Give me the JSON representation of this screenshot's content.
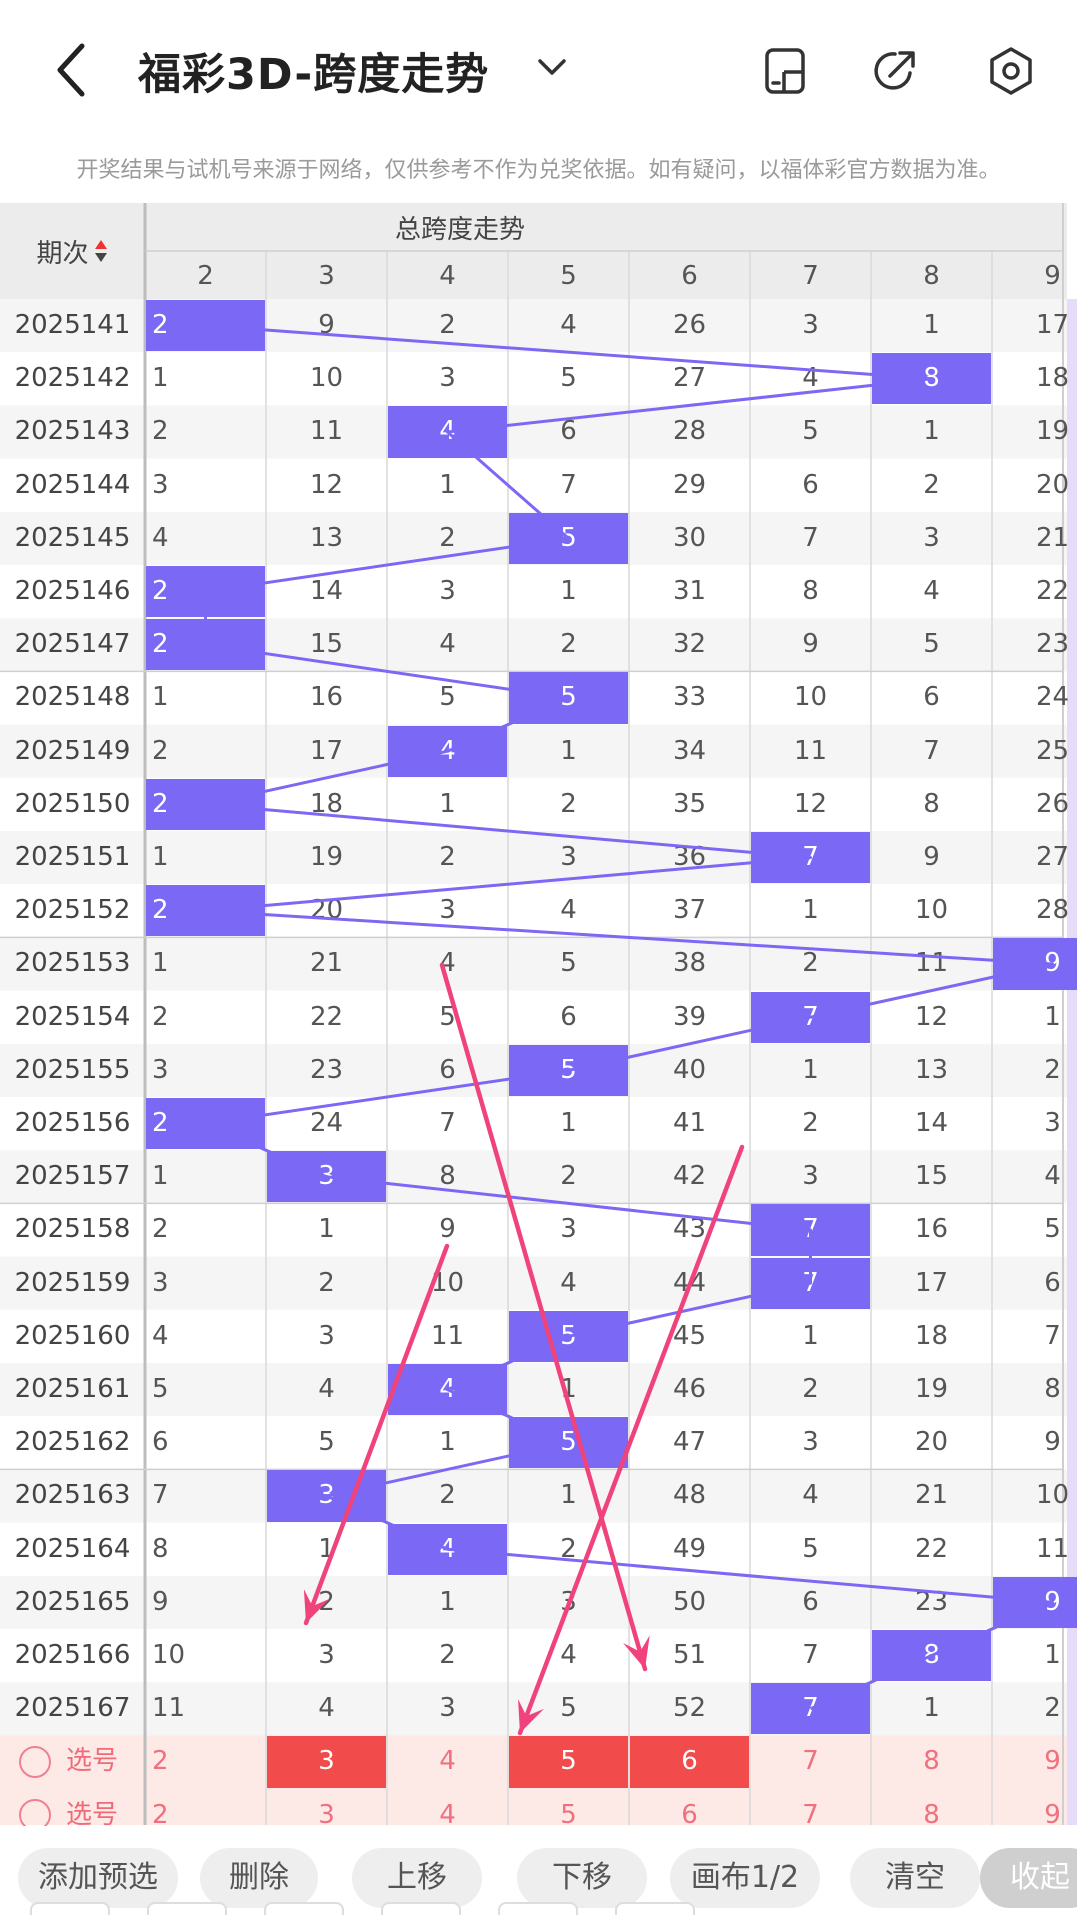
{
  "header": {
    "title": "福彩3D-跨度走势",
    "back_icon": "chevron-left-icon",
    "title_dropdown_icon": "chevron-down-icon",
    "icons": [
      "phone-layout-icon",
      "share-arrow-icon",
      "settings-icon"
    ]
  },
  "disclaimer": "开奖结果与试机号来源于网络，仅供参考不作为兑奖依据。如有疑问，以福体彩官方数据为准。",
  "table": {
    "period_header": "期次",
    "group_title": "总跨度走势",
    "columns": [
      "2",
      "3",
      "4",
      "5",
      "6",
      "7",
      "8",
      "9"
    ],
    "rows": [
      {
        "period": "2025141",
        "cells": [
          "2",
          "9",
          "2",
          "4",
          "26",
          "3",
          "1",
          "17"
        ],
        "hit": 0
      },
      {
        "period": "2025142",
        "cells": [
          "1",
          "10",
          "3",
          "5",
          "27",
          "4",
          "8",
          "18"
        ],
        "hit": 6
      },
      {
        "period": "2025143",
        "cells": [
          "2",
          "11",
          "4",
          "6",
          "28",
          "5",
          "1",
          "19"
        ],
        "hit": 2
      },
      {
        "period": "2025144",
        "cells": [
          "3",
          "12",
          "1",
          "7",
          "29",
          "6",
          "2",
          "20"
        ],
        "hit": -1
      },
      {
        "period": "2025145",
        "cells": [
          "4",
          "13",
          "2",
          "5",
          "30",
          "7",
          "3",
          "21"
        ],
        "hit": 3
      },
      {
        "period": "2025146",
        "cells": [
          "2",
          "14",
          "3",
          "1",
          "31",
          "8",
          "4",
          "22"
        ],
        "hit": 0
      },
      {
        "period": "2025147",
        "cells": [
          "2",
          "15",
          "4",
          "2",
          "32",
          "9",
          "5",
          "23"
        ],
        "hit": 0
      },
      {
        "period": "2025148",
        "cells": [
          "1",
          "16",
          "5",
          "5",
          "33",
          "10",
          "6",
          "24"
        ],
        "hit": 3
      },
      {
        "period": "2025149",
        "cells": [
          "2",
          "17",
          "4",
          "1",
          "34",
          "11",
          "7",
          "25"
        ],
        "hit": 2
      },
      {
        "period": "2025150",
        "cells": [
          "2",
          "18",
          "1",
          "2",
          "35",
          "12",
          "8",
          "26"
        ],
        "hit": 0
      },
      {
        "period": "2025151",
        "cells": [
          "1",
          "19",
          "2",
          "3",
          "36",
          "7",
          "9",
          "27"
        ],
        "hit": 5
      },
      {
        "period": "2025152",
        "cells": [
          "2",
          "20",
          "3",
          "4",
          "37",
          "1",
          "10",
          "28"
        ],
        "hit": 0
      },
      {
        "period": "2025153",
        "cells": [
          "1",
          "21",
          "4",
          "5",
          "38",
          "2",
          "11",
          "9"
        ],
        "hit": 7
      },
      {
        "period": "2025154",
        "cells": [
          "2",
          "22",
          "5",
          "6",
          "39",
          "7",
          "12",
          "1"
        ],
        "hit": 5
      },
      {
        "period": "2025155",
        "cells": [
          "3",
          "23",
          "6",
          "5",
          "40",
          "1",
          "13",
          "2"
        ],
        "hit": 3
      },
      {
        "period": "2025156",
        "cells": [
          "2",
          "24",
          "7",
          "1",
          "41",
          "2",
          "14",
          "3"
        ],
        "hit": 0
      },
      {
        "period": "2025157",
        "cells": [
          "1",
          "3",
          "8",
          "2",
          "42",
          "3",
          "15",
          "4"
        ],
        "hit": 1
      },
      {
        "period": "2025158",
        "cells": [
          "2",
          "1",
          "9",
          "3",
          "43",
          "7",
          "16",
          "5"
        ],
        "hit": 5
      },
      {
        "period": "2025159",
        "cells": [
          "3",
          "2",
          "10",
          "4",
          "44",
          "7",
          "17",
          "6"
        ],
        "hit": 5
      },
      {
        "period": "2025160",
        "cells": [
          "4",
          "3",
          "11",
          "5",
          "45",
          "1",
          "18",
          "7"
        ],
        "hit": 3
      },
      {
        "period": "2025161",
        "cells": [
          "5",
          "4",
          "4",
          "1",
          "46",
          "2",
          "19",
          "8"
        ],
        "hit": 2
      },
      {
        "period": "2025162",
        "cells": [
          "6",
          "5",
          "1",
          "5",
          "47",
          "3",
          "20",
          "9"
        ],
        "hit": 3
      },
      {
        "period": "2025163",
        "cells": [
          "7",
          "3",
          "2",
          "1",
          "48",
          "4",
          "21",
          "10"
        ],
        "hit": 1
      },
      {
        "period": "2025164",
        "cells": [
          "8",
          "1",
          "4",
          "2",
          "49",
          "5",
          "22",
          "11"
        ],
        "hit": 2
      },
      {
        "period": "2025165",
        "cells": [
          "9",
          "2",
          "1",
          "3",
          "50",
          "6",
          "23",
          "9"
        ],
        "hit": 7
      },
      {
        "period": "2025166",
        "cells": [
          "10",
          "3",
          "2",
          "4",
          "51",
          "7",
          "8",
          "1"
        ],
        "hit": 6
      },
      {
        "period": "2025167",
        "cells": [
          "11",
          "4",
          "3",
          "5",
          "52",
          "7",
          "1",
          "2"
        ],
        "hit": 5
      }
    ],
    "select_rows": [
      {
        "label": "选号",
        "values": [
          "2",
          "3",
          "4",
          "5",
          "6",
          "7",
          "8",
          "9"
        ],
        "selected": [
          1,
          3,
          4
        ]
      },
      {
        "label": "选号",
        "values": [
          "2",
          "3",
          "4",
          "5",
          "6",
          "7",
          "8",
          "9"
        ],
        "selected": []
      }
    ]
  },
  "toolbar": [
    "添加预选",
    "删除",
    "上移",
    "下移",
    "画布1/2",
    "清空",
    "收起"
  ],
  "colors": {
    "hit_cell": "#7b68f4",
    "trend_line": "#7b68f4",
    "selected_cell": "#f24b4b",
    "select_row_bg": "#fde9e5",
    "annotation_arrow": "#f0437c"
  }
}
